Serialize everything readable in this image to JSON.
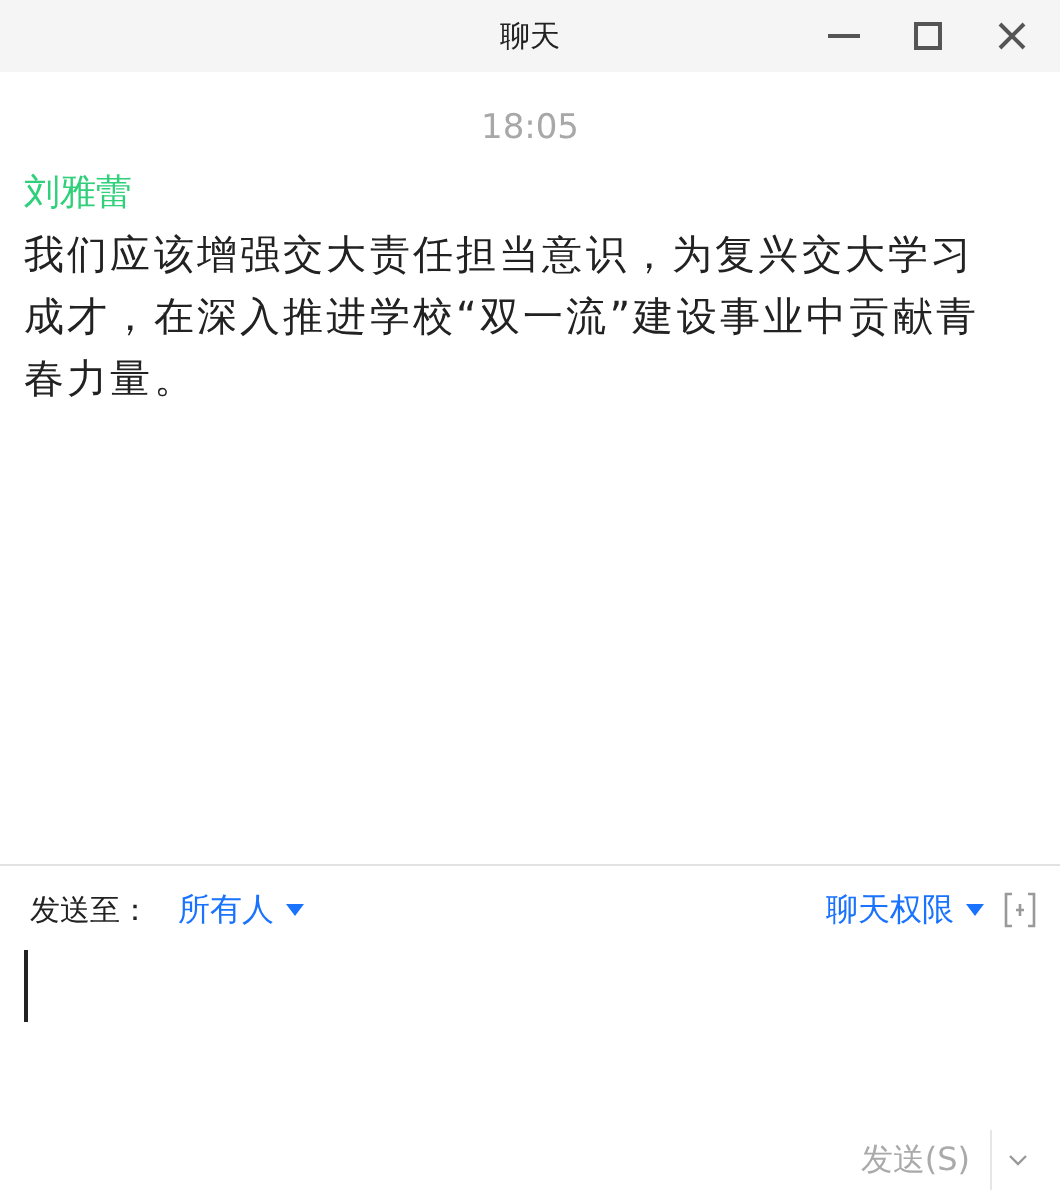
{
  "window": {
    "title": "聊天"
  },
  "messages": [
    {
      "time": "18:05",
      "sender": "刘雅蕾",
      "text": "我们应该增强交大责任担当意识，为复兴交大学习成才，在深入推进学校“双一流”建设事业中贡献青春力量。"
    }
  ],
  "composer": {
    "send_to_label": "发送至：",
    "recipient": "所有人",
    "permission": "聊天权限",
    "send_button": {
      "label": "发送(S)",
      "disabled": true
    }
  }
}
